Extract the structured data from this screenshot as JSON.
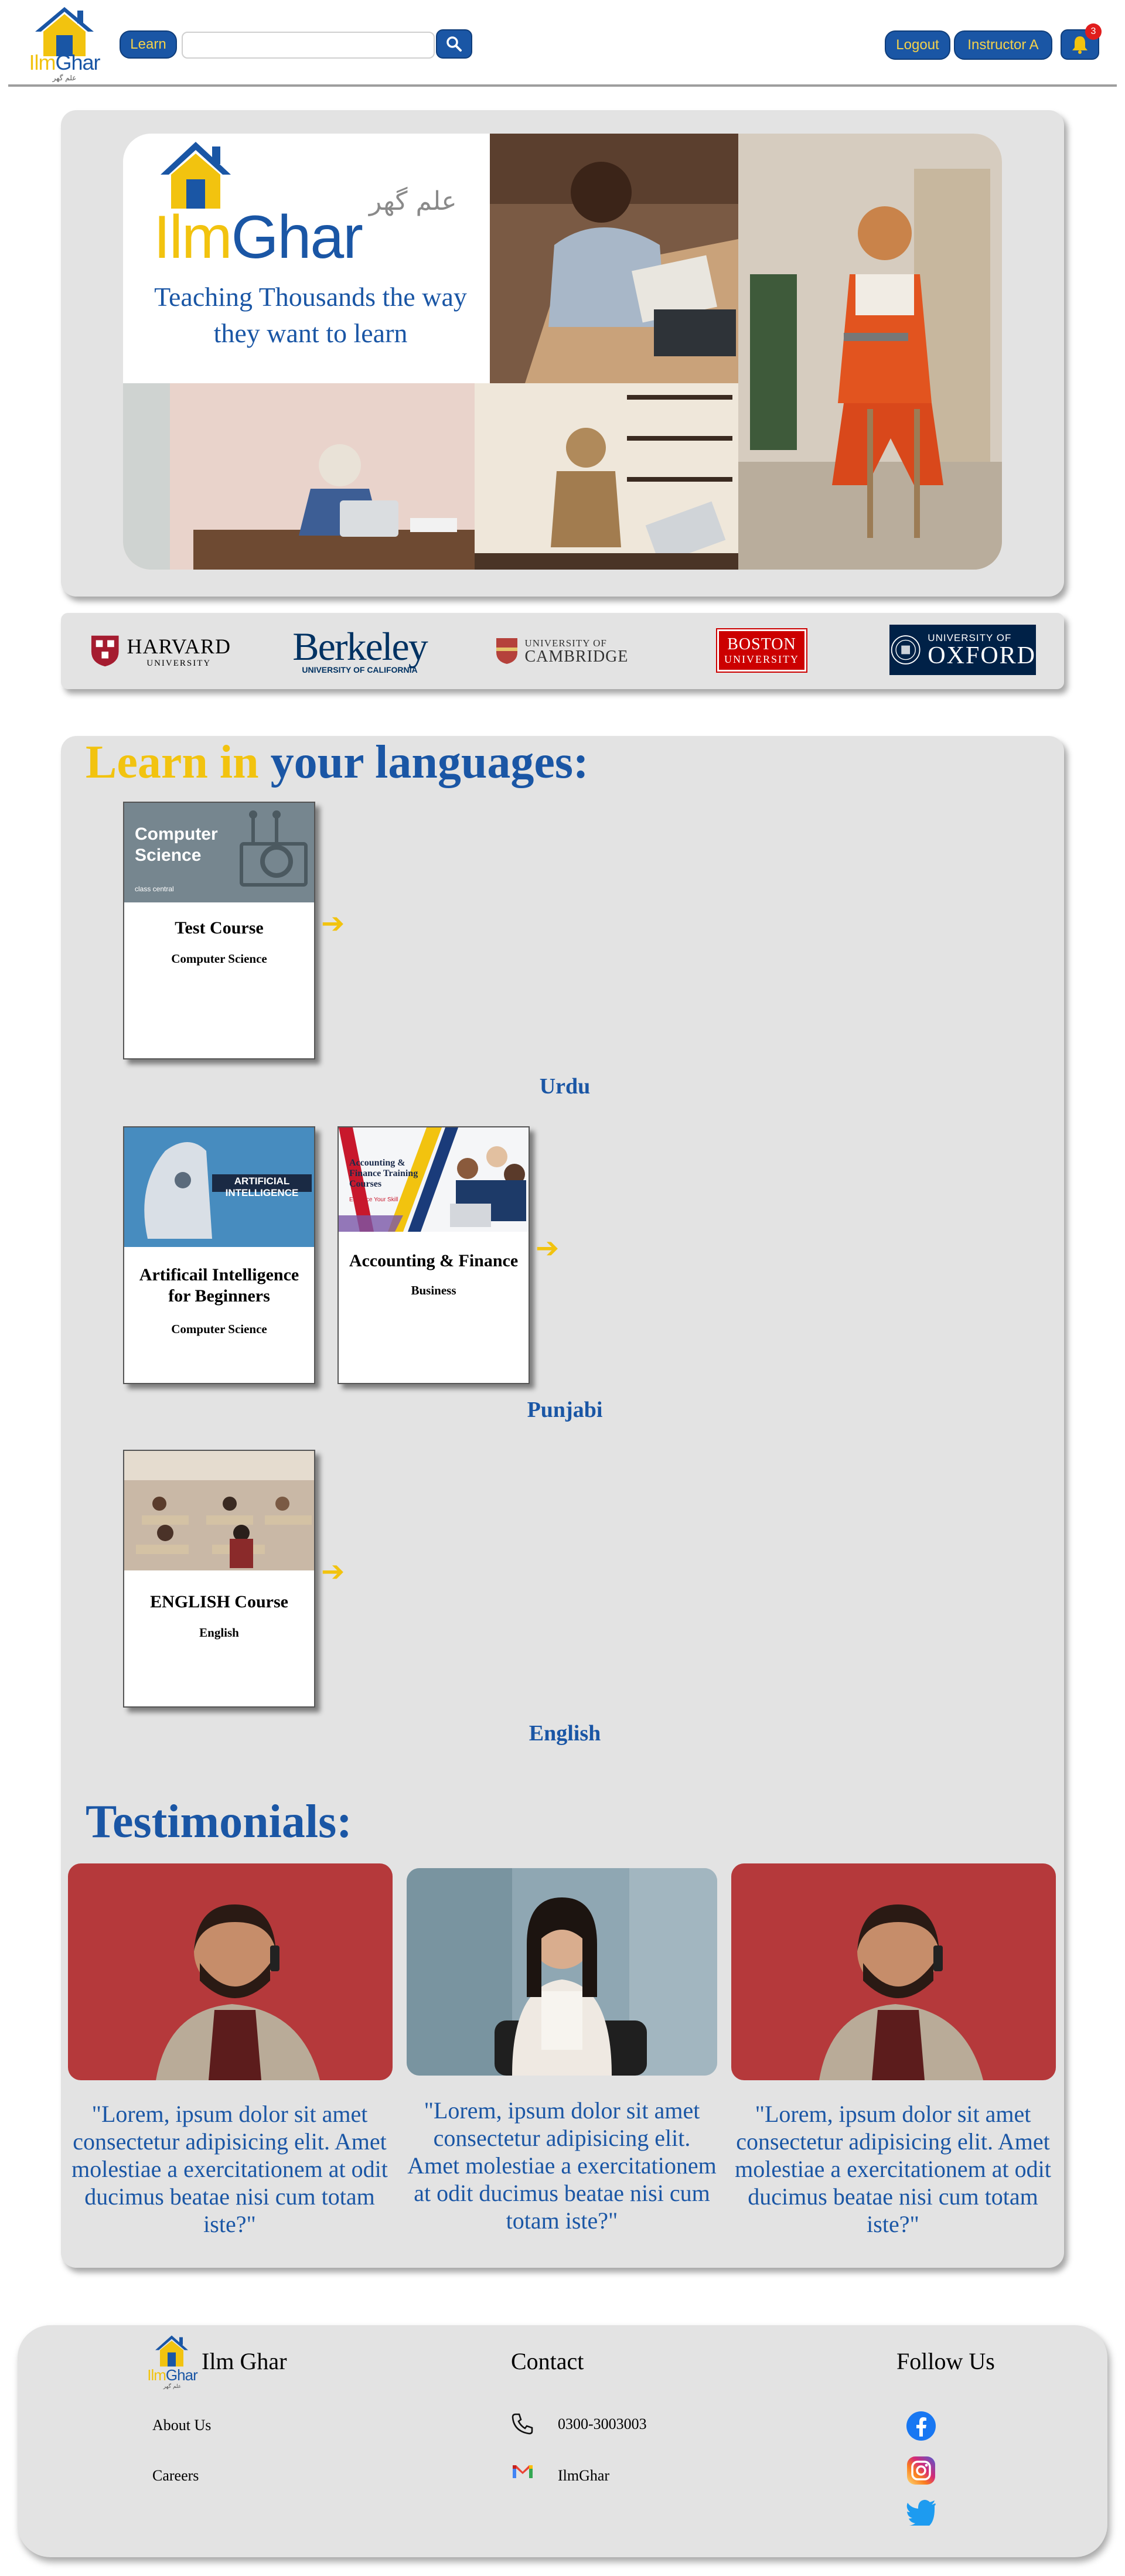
{
  "navbar": {
    "logo_word_a": "Ilm",
    "logo_word_b": "Ghar",
    "logo_urdu": "علم گھر",
    "learn_label": "Learn",
    "search_value": "",
    "search_placeholder": "",
    "logout_label": "Logout",
    "user_label": "Instructor A",
    "notification_count": "3"
  },
  "hero": {
    "logo_word_a": "Ilm",
    "logo_word_b": "Ghar",
    "logo_urdu": "علم گھر",
    "tagline": "Teaching Thousands the way they want to learn"
  },
  "universities": [
    {
      "name": "HARVARD",
      "sub": "UNIVERSITY"
    },
    {
      "name": "Berkeley",
      "sub": "UNIVERSITY OF CALIFORNIA"
    },
    {
      "name": "CAMBRIDGE",
      "sub": "UNIVERSITY OF"
    },
    {
      "name": "BOSTON",
      "sub": "UNIVERSITY"
    },
    {
      "name": "OXFORD",
      "sub": "UNIVERSITY OF"
    }
  ],
  "languages": {
    "heading_a": "Learn in",
    "heading_b": "your languages:",
    "groups": [
      {
        "label": "Urdu",
        "courses": [
          {
            "title": "Test Course",
            "category": "Computer Science",
            "thumb_text": "Computer Science",
            "thumb_sub": "class central"
          }
        ]
      },
      {
        "label": "Punjabi",
        "courses": [
          {
            "title": "Artificail Intelligence for Beginners",
            "category": "Computer Science",
            "thumb_text": "ARTIFICIAL INTELLIGENCE"
          },
          {
            "title": "Accounting & Finance",
            "category": "Business",
            "thumb_text": "Accounting & Finance Training Courses",
            "thumb_sub": "Enhance Your Skill"
          }
        ]
      },
      {
        "label": "English",
        "courses": [
          {
            "title": "ENGLISH Course",
            "category": "English"
          }
        ]
      }
    ]
  },
  "testimonials": {
    "heading": "Testimonials:",
    "items": [
      {
        "quote": "\"Lorem, ipsum dolor sit amet consectetur adipisicing elit. Amet molestiae a exercitationem at odit ducimus beatae nisi cum totam iste?\""
      },
      {
        "quote": "\"Lorem, ipsum dolor sit amet consectetur adipisicing elit. Amet molestiae a exercitationem at odit ducimus beatae nisi cum totam iste?\""
      },
      {
        "quote": "\"Lorem, ipsum dolor sit amet consectetur adipisicing elit. Amet molestiae a exercitationem at odit ducimus beatae nisi cum totam iste?\""
      }
    ]
  },
  "footer": {
    "brand": "Ilm Ghar",
    "logo_word_a": "Ilm",
    "logo_word_b": "Ghar",
    "logo_urdu": "علم گھر",
    "links": [
      "About Us",
      "Careers"
    ],
    "contact_heading": "Contact",
    "phone": "0300-3003003",
    "email": "IlmGhar",
    "follow_heading": "Follow Us",
    "social_icons": [
      "facebook-icon",
      "instagram-icon",
      "twitter-icon"
    ]
  },
  "colors": {
    "brand_blue": "#1a56a5",
    "brand_yellow": "#f2c30f",
    "panel_gray": "#e3e3e3"
  }
}
